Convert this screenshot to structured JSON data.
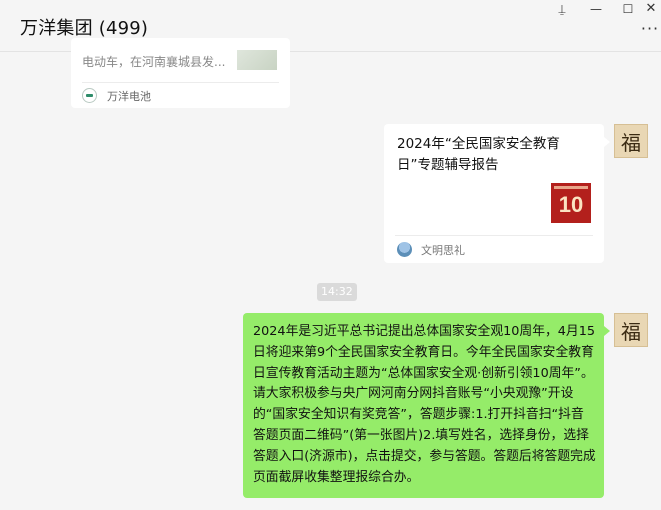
{
  "header": {
    "title": "万洋集团 (499)",
    "controls": {
      "pin": "⍊",
      "minimize": "—",
      "maximize": "☐",
      "close": "✕",
      "more": "···"
    }
  },
  "messages": {
    "top_card": {
      "text": "电动车，在河南襄城县发...",
      "source": "万洋电池"
    },
    "article_card": {
      "title": "2024年“全民国家安全教育日”专题辅导报告",
      "thumb_number": "10",
      "source": "文明思礼"
    },
    "time": "14:32",
    "text_message": "2024年是习近平总书记提出总体国家安全观10周年，4月15日将迎来第9个全民国家安全教育日。今年全民国家安全教育日宣传教育活动主题为“总体国家安全观·创新引领10周年”。请大家积极参与央广网河南分网抖音账号“小央观豫”开设的“国家安全知识有奖竞答”，答题步骤:1.打开抖音扫“抖音答题页面二维码”(第一张图片)2.填写姓名，选择身份，选择答题入口(济源市)，点击提交，参与答题。答题后将答题完成页面截屏收集整理报综合办。",
    "avatar_glyph": "福"
  },
  "colors": {
    "bubble_green": "#95ec69",
    "background": "#f5f5f5",
    "card": "#ffffff"
  }
}
